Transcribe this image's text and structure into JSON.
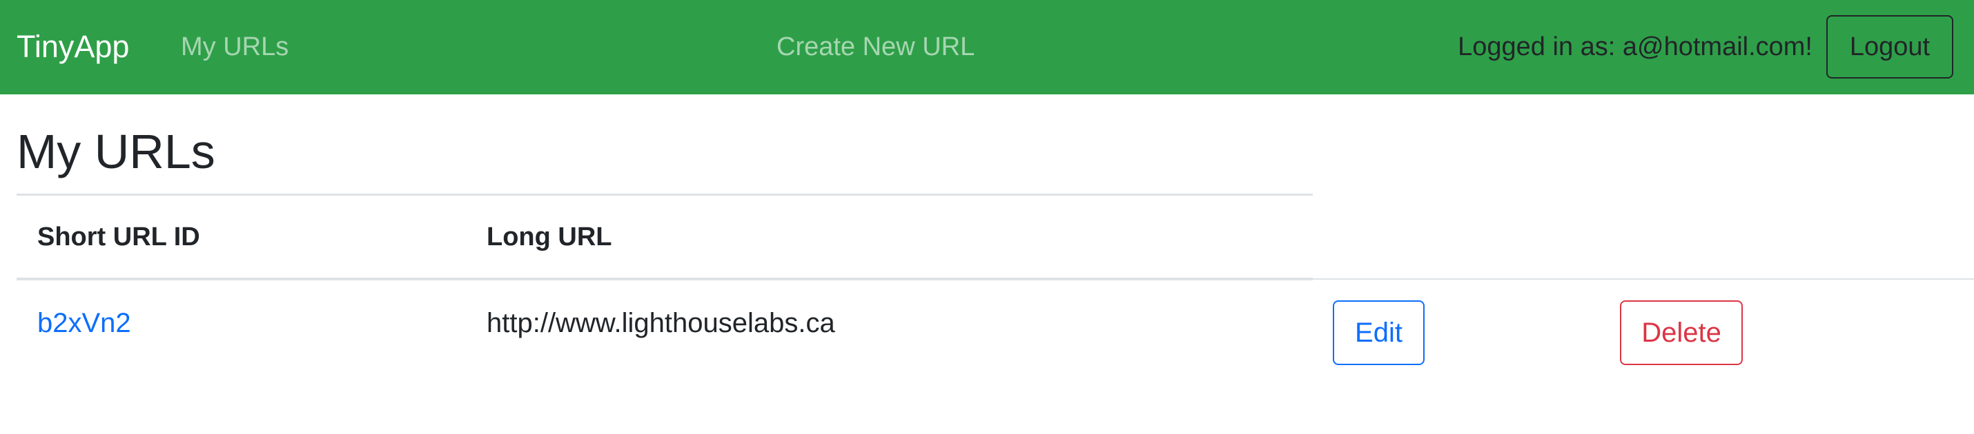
{
  "navbar": {
    "brand": "TinyApp",
    "links": [
      {
        "label": "My URLs"
      },
      {
        "label": "Create New URL"
      }
    ],
    "logged_in_text": "Logged in as: a@hotmail.com!",
    "logout_label": "Logout",
    "background_color": "#2e9f48"
  },
  "main": {
    "title": "My URLs",
    "table": {
      "headers": [
        "Short URL ID",
        "Long URL"
      ],
      "rows": [
        {
          "short_id": "b2xVn2",
          "long_url": "http://www.lighthouselabs.ca",
          "edit_label": "Edit",
          "delete_label": "Delete"
        }
      ]
    }
  },
  "colors": {
    "link": "#0d6efd",
    "danger": "#dc3545",
    "text": "#212529"
  }
}
